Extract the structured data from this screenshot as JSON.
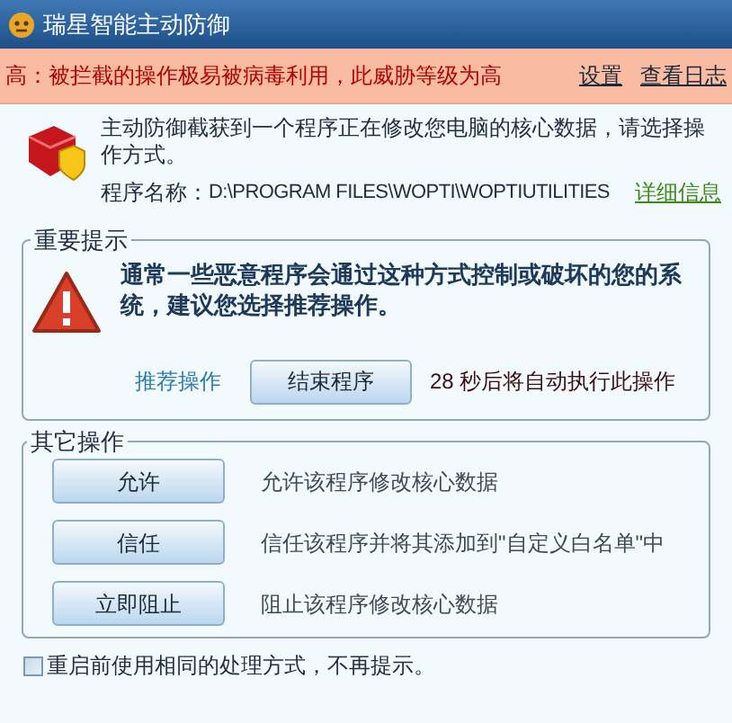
{
  "window": {
    "title": "瑞星智能主动防御"
  },
  "alert": {
    "text": "高：被拦截的操作极易被病毒利用，此威胁等级为高",
    "links": [
      "设置",
      "查看日志"
    ]
  },
  "intro": {
    "message": "主动防御截获到一个程序正在修改您电脑的核心数据，请选择操作方式。",
    "program_label": "程序名称：",
    "program_path": "D:\\PROGRAM FILES\\WOPTI\\WOPTIUTILITIES",
    "details_link": "详细信息"
  },
  "important": {
    "legend": "重要提示",
    "warning": "通常一些恶意程序会通过这种方式控制或破坏的您的系统，建议您选择推荐操作。",
    "recommend_label": "推荐操作",
    "recommend_button": "结束程序",
    "countdown": "28 秒后将自动执行此操作"
  },
  "other": {
    "legend": "其它操作",
    "actions": [
      {
        "button": "允许",
        "description": "允许该程序修改核心数据"
      },
      {
        "button": "信任",
        "description": "信任该程序并将其添加到\"自定义白名单\"中"
      },
      {
        "button": "立即阻止",
        "description": "阻止该程序修改核心数据"
      }
    ]
  },
  "remember": {
    "label": "重启前使用相同的处理方式，不再提示。",
    "checked": false
  }
}
